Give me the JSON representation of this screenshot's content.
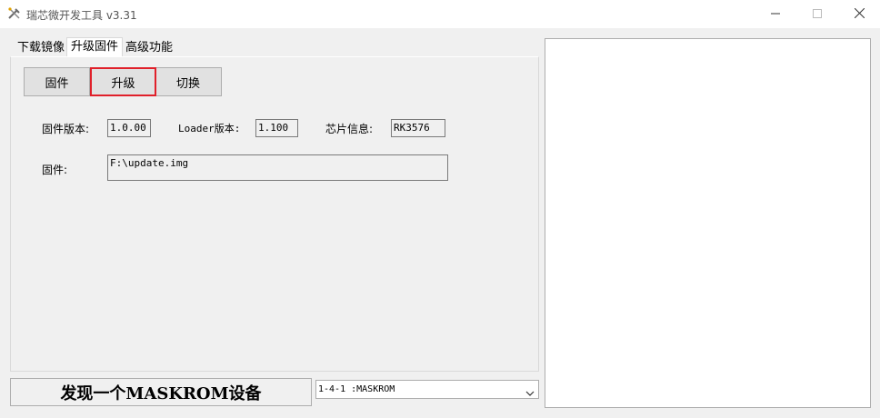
{
  "window": {
    "title": "瑞芯微开发工具 v3.31",
    "icons": {
      "app": "tools-icon",
      "minimize": "minimize-icon",
      "maximize": "maximize-icon",
      "close": "close-icon"
    }
  },
  "tabs": [
    {
      "label": "下载镜像"
    },
    {
      "label": "升级固件",
      "active": true
    },
    {
      "label": "高级功能"
    }
  ],
  "upgrade": {
    "buttons": {
      "firmware": "固件",
      "upgrade": "升级",
      "switch": "切换"
    },
    "firmware_version_label": "固件版本:",
    "firmware_version_value": "1.0.00",
    "loader_version_label": "Loader版本:",
    "loader_version_value": "1.100",
    "chip_info_label": "芯片信息:",
    "chip_info_value": "RK3576",
    "firmware_path_label": "固件:",
    "firmware_path_value": "F:\\update.img"
  },
  "status": {
    "message": "发现一个MASKROM设备",
    "device_selected": "1-4-1 :MASKROM"
  },
  "colors": {
    "highlight_border": "#e0202a"
  }
}
